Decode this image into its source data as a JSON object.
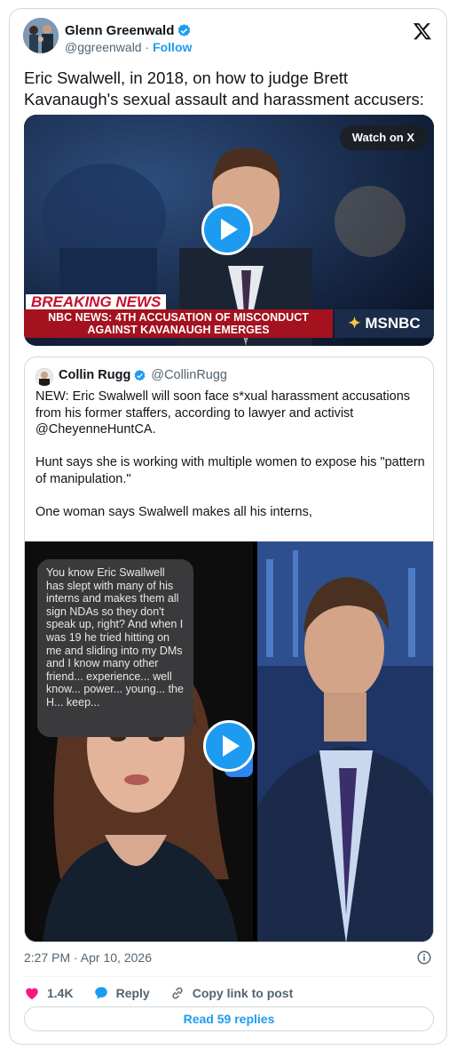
{
  "tweet": {
    "author_name": "Glenn Greenwald",
    "author_handle": "@ggreenwald",
    "separator": "·",
    "follow_label": "Follow",
    "text": "Eric Swalwell, in 2018, on how to judge Brett Kavanaugh's sexual assault and harassment accusers:",
    "timestamp": "2:27 PM · Apr 10, 2026",
    "likes": "1.4K",
    "reply_label": "Reply",
    "copy_link_label": "Copy link to post",
    "read_replies_label": "Read 59 replies"
  },
  "video1": {
    "watch_label": "Watch on X",
    "breaking": "BREAKING NEWS",
    "headline_line1": "NBC NEWS: 4TH ACCUSATION OF MISCONDUCT",
    "headline_line2": "AGAINST KAVANAUGH EMERGES",
    "network": "MSNBC"
  },
  "quote": {
    "author_name": "Collin Rugg",
    "author_handle": "@CollinRugg",
    "paragraph1": "NEW: Eric Swalwell will soon face s*xual harassment accusations from his former staffers, according to lawyer and activist @CheyenneHuntCA.",
    "paragraph2": "Hunt says she is working with multiple women to expose his \"pattern of manipulation.\"",
    "paragraph3": "One woman says Swalwell makes all his interns,",
    "bubble_text": "You know Eric Swallwell has slept with many of his interns and makes them all sign NDAs so they don't speak up, right? And when I was 19 he tried hitting on me and sliding into my DMs and I know many other friend... experience... well know... power... young... the H... keep..."
  },
  "icons": {
    "verified": "verified-badge-icon",
    "x_logo": "x-logo-icon",
    "play": "play-icon",
    "info": "info-icon",
    "heart": "heart-icon",
    "reply": "reply-bubble-icon",
    "link": "link-icon"
  },
  "colors": {
    "accent": "#1d9bf0",
    "like": "#f91880",
    "muted": "#536471",
    "breaking_red": "#a3121e"
  }
}
